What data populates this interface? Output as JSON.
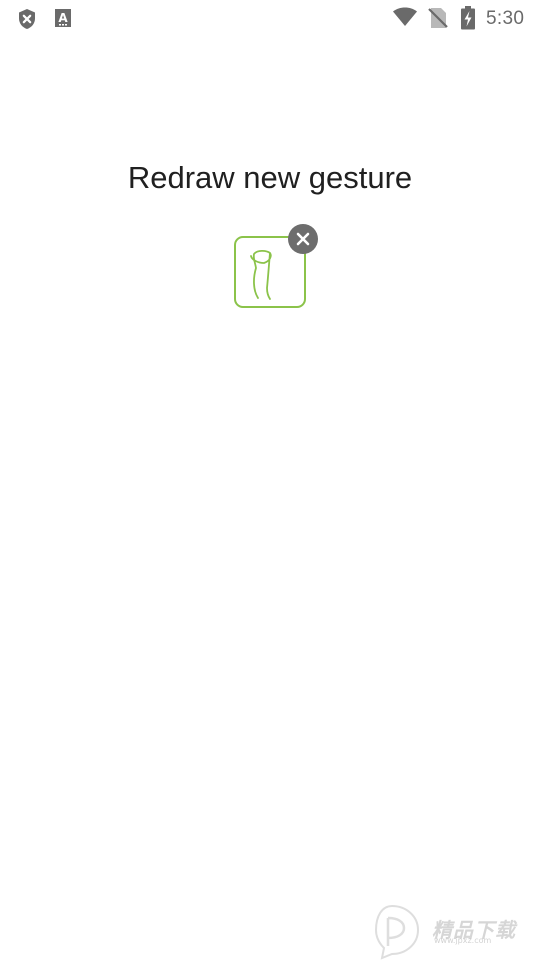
{
  "status_bar": {
    "time": "5:30",
    "icons_left": [
      "shield-x-icon",
      "keyboard-a-icon"
    ],
    "icons_right": [
      "wifi-icon",
      "no-sim-icon",
      "battery-charging-icon"
    ]
  },
  "main": {
    "title": "Redraw new gesture",
    "gesture": {
      "stroke_color": "#8bc34a",
      "remove_icon": "close-icon"
    }
  },
  "watermark": {
    "text": "精品下载",
    "sub": "www.jpxz.com"
  }
}
